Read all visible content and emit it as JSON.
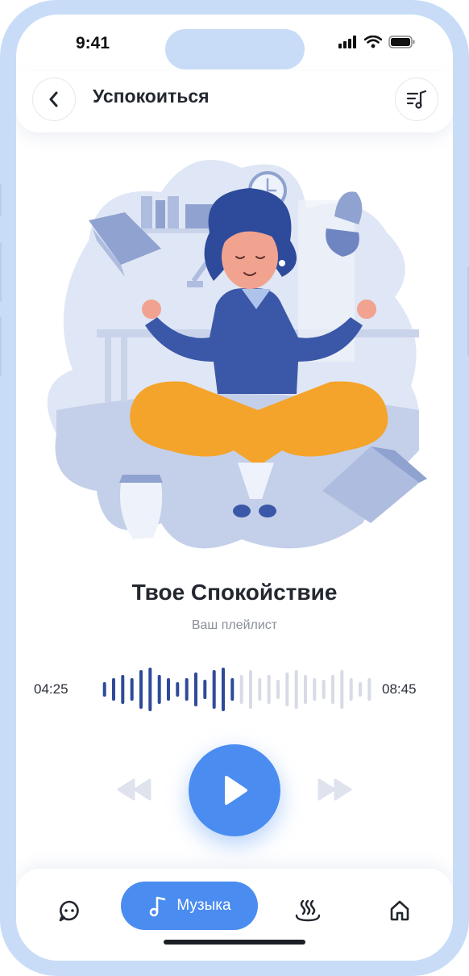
{
  "status_bar": {
    "time": "9:41"
  },
  "header": {
    "title": "Успокоиться",
    "back_icon": "chevron-left-icon",
    "playlist_icon": "music-list-icon"
  },
  "track": {
    "title": "Твое Спокойствие",
    "subtitle": "Ваш плейлист"
  },
  "progress": {
    "current": "04:25",
    "total": "08:45",
    "fraction": 0.5
  },
  "colors": {
    "accent": "#4a8cf0",
    "played": "#2e4a9a",
    "unplayed": "#d6dbe6",
    "frame": "#c9dcf7"
  },
  "bottom_nav": {
    "items": [
      {
        "icon": "chat-icon"
      },
      {
        "icon": "music-note-icon",
        "label": "Музыка",
        "active": true
      },
      {
        "icon": "steam-icon"
      },
      {
        "icon": "home-icon"
      }
    ]
  }
}
